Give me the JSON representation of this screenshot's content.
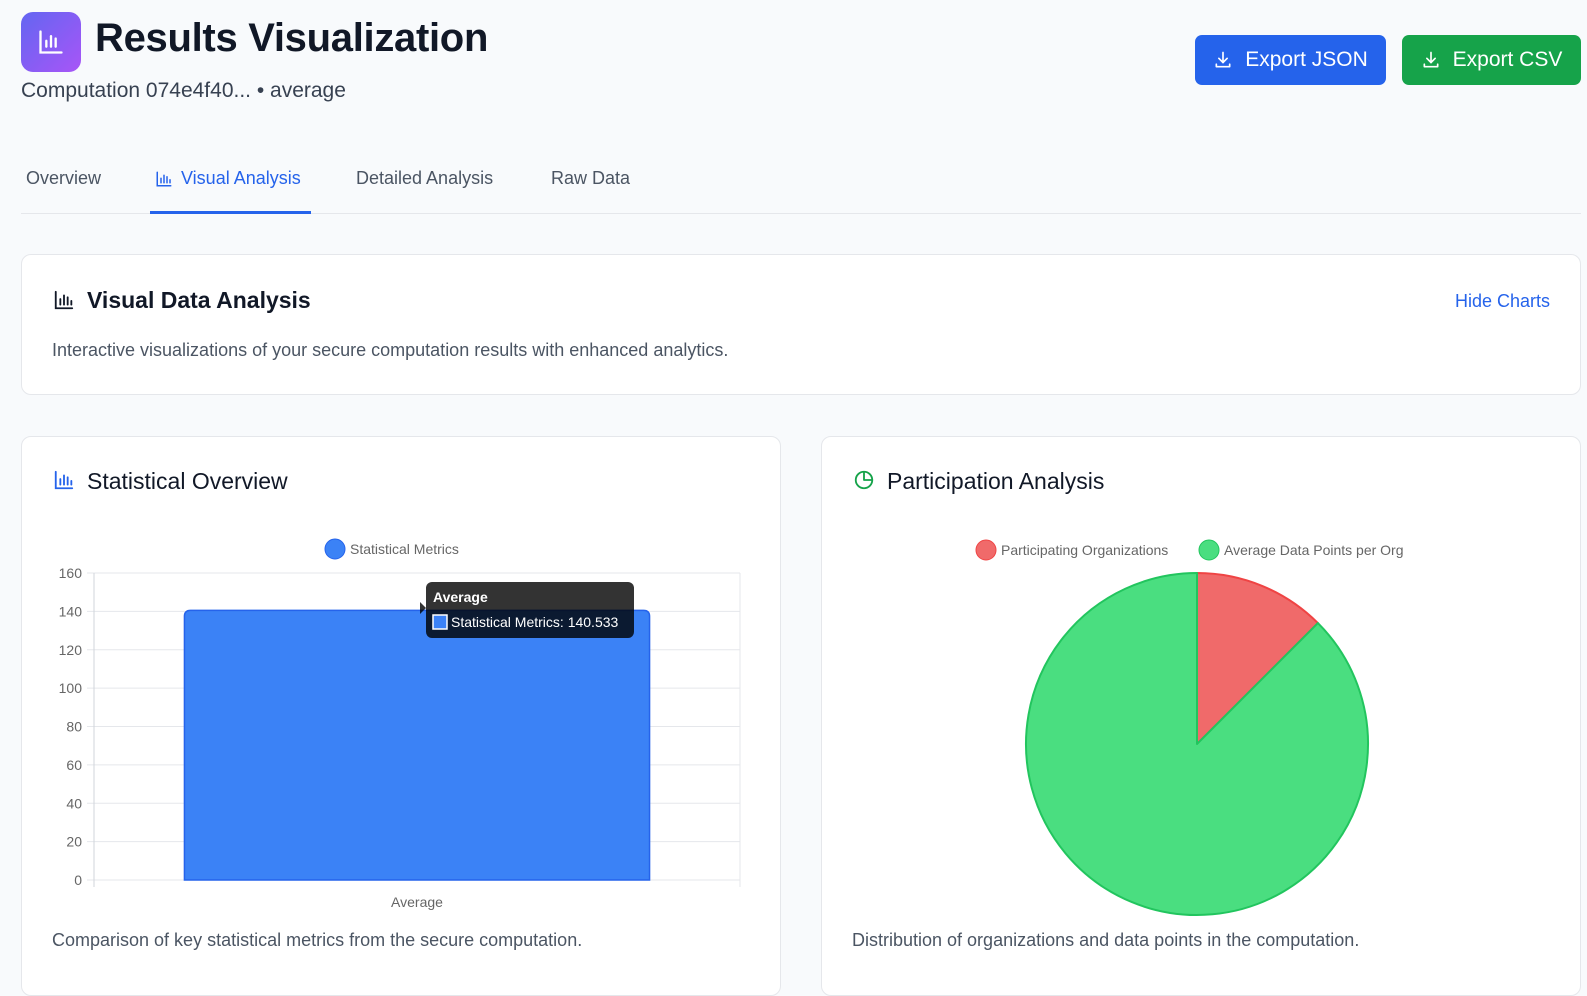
{
  "header": {
    "title": "Results Visualization",
    "subtitle": "Computation 074e4f40... • average",
    "export_json_label": "Export JSON",
    "export_csv_label": "Export CSV"
  },
  "tabs": [
    {
      "label": "Overview",
      "active": false
    },
    {
      "label": "Visual Analysis",
      "active": true
    },
    {
      "label": "Detailed Analysis",
      "active": false
    },
    {
      "label": "Raw Data",
      "active": false
    }
  ],
  "visual_panel": {
    "title": "Visual Data Analysis",
    "description": "Interactive visualizations of your secure computation results with enhanced analytics.",
    "toggle_label": "Hide Charts"
  },
  "stat_card": {
    "title": "Statistical Overview",
    "description": "Comparison of key statistical metrics from the secure computation."
  },
  "participation_card": {
    "title": "Participation Analysis",
    "description": "Distribution of organizations and data points in the computation."
  },
  "tooltip": {
    "title": "Average",
    "text": "Statistical Metrics: 140.533"
  },
  "colors": {
    "accent": "#2563eb",
    "export_csv": "#16a34a",
    "bar": "#3b82f6",
    "pie_red": "#f06a6a",
    "pie_green": "#4ade80"
  },
  "chart_data": [
    {
      "type": "bar",
      "categories": [
        "Average"
      ],
      "series": [
        {
          "name": "Statistical Metrics",
          "values": [
            140.533
          ]
        }
      ],
      "ylim": [
        0,
        160
      ],
      "yticks": [
        0,
        20,
        40,
        60,
        80,
        100,
        120,
        140,
        160
      ],
      "grid": true,
      "legend": "top-center"
    },
    {
      "type": "pie",
      "labels": [
        "Participating Organizations",
        "Average Data Points per Org"
      ],
      "values": [
        12.5,
        87.5
      ],
      "legend": "top-center"
    }
  ]
}
